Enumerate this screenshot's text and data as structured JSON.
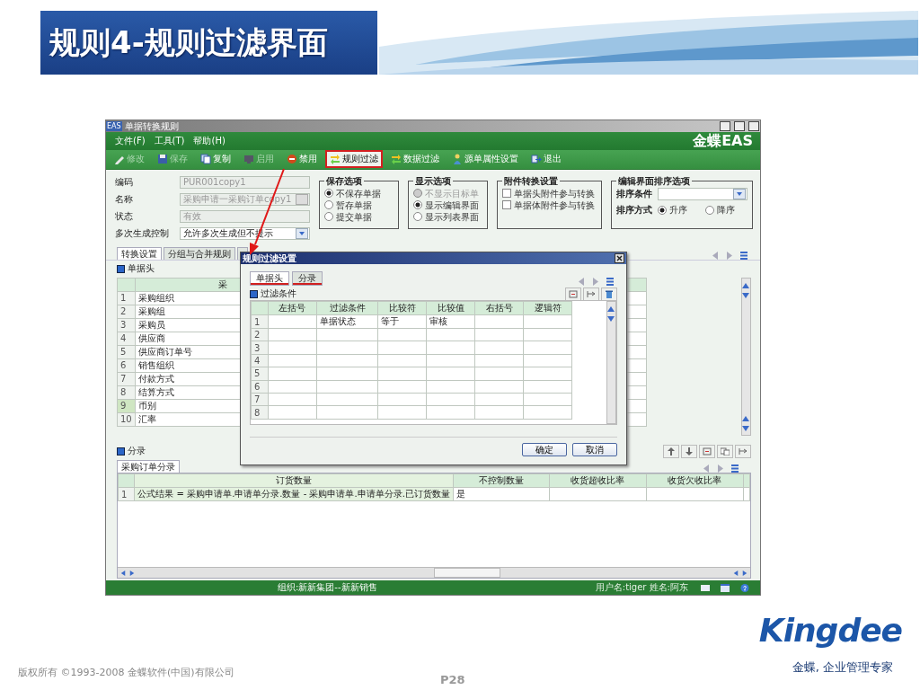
{
  "slide": {
    "title": "规则4-规则过滤界面",
    "copyright": "版权所有 ©1993-2008 金蝶软件(中国)有限公司",
    "page": "P28",
    "logo": "Kingdee",
    "tagline": "金蝶, 企业管理专家"
  },
  "window": {
    "icon": "EAS",
    "title": "单据转换规则",
    "brand": "金蝶EAS"
  },
  "menu": [
    "文件(F)",
    "工具(T)",
    "帮助(H)"
  ],
  "toolbar": [
    {
      "label": "修改",
      "kind": "edit",
      "disabled": true,
      "highlighted": false
    },
    {
      "label": "保存",
      "kind": "save",
      "disabled": true,
      "highlighted": false
    },
    {
      "label": "复制",
      "kind": "copy",
      "disabled": false,
      "highlighted": false
    },
    {
      "label": "启用",
      "kind": "enable",
      "disabled": true,
      "highlighted": false
    },
    {
      "label": "禁用",
      "kind": "disable",
      "disabled": false,
      "highlighted": false
    },
    {
      "label": "规则过滤",
      "kind": "filter",
      "disabled": false,
      "highlighted": true
    },
    {
      "label": "数据过滤",
      "kind": "filter",
      "disabled": false,
      "highlighted": false
    },
    {
      "label": "源单属性设置",
      "kind": "properties",
      "disabled": false,
      "highlighted": false
    },
    {
      "label": "退出",
      "kind": "exit",
      "disabled": false,
      "highlighted": false
    }
  ],
  "fields": [
    {
      "label": "编码",
      "kind": "text",
      "value": "PUR001copy1",
      "disabled": true
    },
    {
      "label": "名称",
      "kind": "lookup",
      "value": "采购申请一采购订单copy1",
      "disabled": true
    },
    {
      "label": "状态",
      "kind": "text",
      "value": "有效",
      "disabled": true
    },
    {
      "label": "多次生成控制",
      "kind": "select",
      "value": "允许多次生成但不提示",
      "disabled": false
    }
  ],
  "groups": [
    {
      "title": "保存选项",
      "kind": "options",
      "options": [
        {
          "kind": "radio",
          "label": "不保存单据",
          "selected": true,
          "disabled": false
        },
        {
          "kind": "radio",
          "label": "暂存单据",
          "selected": false,
          "disabled": false
        },
        {
          "kind": "radio",
          "label": "提交单据",
          "selected": false,
          "disabled": false
        }
      ]
    },
    {
      "title": "显示选项",
      "kind": "options",
      "options": [
        {
          "kind": "radio",
          "label": "不显示目标单",
          "selected": false,
          "disabled": true
        },
        {
          "kind": "radio",
          "label": "显示编辑界面",
          "selected": true,
          "disabled": false
        },
        {
          "kind": "radio",
          "label": "显示列表界面",
          "selected": false,
          "disabled": false
        }
      ]
    },
    {
      "title": "附件转换设置",
      "kind": "options",
      "options": [
        {
          "kind": "checkbox",
          "label": "单据头附件参与转换",
          "checked": false,
          "disabled": false
        },
        {
          "kind": "checkbox",
          "label": "单据体附件参与转换",
          "checked": false,
          "disabled": false
        }
      ]
    },
    {
      "title": "编辑界面排序选项",
      "kind": "sort",
      "condition_label": "排序条件",
      "order_label": "排序方式",
      "orders": [
        {
          "label": "升序",
          "selected": true
        },
        {
          "label": "降序",
          "selected": false
        }
      ]
    }
  ],
  "tabs": [
    {
      "label": "转换设置",
      "selected": true
    },
    {
      "label": "分组与合并规则",
      "selected": false
    },
    {
      "selected": false
    }
  ],
  "header_section": {
    "title": "单据头",
    "column": "采",
    "rows": [
      {
        "num": "1",
        "value": "采购组织",
        "selected": false
      },
      {
        "num": "2",
        "value": "采购组",
        "selected": false
      },
      {
        "num": "3",
        "value": "采购员",
        "selected": false
      },
      {
        "num": "4",
        "value": "供应商",
        "selected": false
      },
      {
        "num": "5",
        "value": "供应商订单号",
        "selected": false
      },
      {
        "num": "6",
        "value": "销售组织",
        "selected": false
      },
      {
        "num": "7",
        "value": "付款方式",
        "selected": false
      },
      {
        "num": "8",
        "value": "结算方式",
        "selected": false
      },
      {
        "num": "9",
        "value": "币别",
        "selected": true
      },
      {
        "num": "10",
        "value": "汇率",
        "selected": false
      }
    ]
  },
  "entry_section": {
    "title": "分录",
    "tabs": [
      {
        "label": "采购订单分录",
        "selected": true
      }
    ],
    "columns": [
      {
        "label": "订货数量",
        "kind": "ordered"
      },
      {
        "label": "不控制数量",
        "kind": "uncontrolled"
      },
      {
        "label": "收货超收比率",
        "kind": "over"
      },
      {
        "label": "收货欠收比率",
        "kind": "under"
      }
    ],
    "rows": [
      {
        "num": "1",
        "ordered": "公式结果 = 采购申请单.申请单分录.数量 - 采购申请单.申请单分录.已订货数量",
        "uncontrolled": "是"
      }
    ]
  },
  "status_bar": {
    "org": "组织:新新集团--新新销售",
    "user": "用户名:tiger 姓名:阿东"
  },
  "dialog": {
    "title": "规则过滤设置",
    "tabs": [
      {
        "label": "单据头",
        "selected": true,
        "underlined": true
      },
      {
        "label": "分录",
        "selected": false,
        "underlined": true
      }
    ],
    "section": "过滤条件",
    "columns": [
      {
        "label": "左括号",
        "kind": "left"
      },
      {
        "label": "过滤条件",
        "kind": "condition"
      },
      {
        "label": "比较符",
        "kind": "operator"
      },
      {
        "label": "比较值",
        "kind": "value"
      },
      {
        "label": "右括号",
        "kind": "right"
      },
      {
        "label": "逻辑符",
        "kind": "logic"
      }
    ],
    "rows": [
      {
        "num": "1",
        "condition": "单据状态",
        "operator": "等于",
        "value": "审核"
      },
      {
        "num": "2"
      },
      {
        "num": "3"
      },
      {
        "num": "4"
      },
      {
        "num": "5"
      },
      {
        "num": "6"
      },
      {
        "num": "7"
      },
      {
        "num": "8"
      }
    ],
    "buttons": [
      "确定",
      "取消"
    ]
  }
}
